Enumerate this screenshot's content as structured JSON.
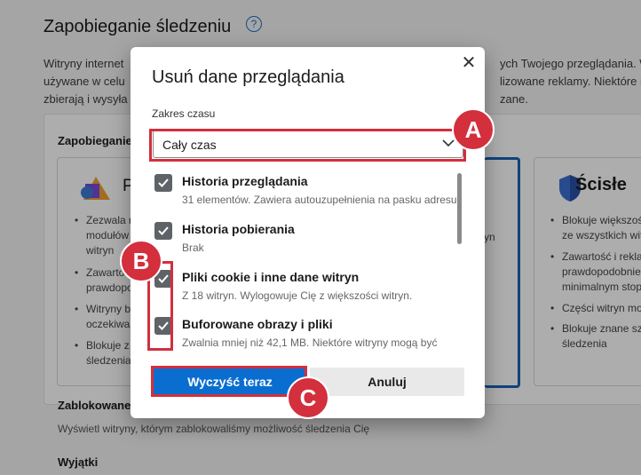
{
  "background": {
    "title": "Zapobieganie śledzeniu",
    "help_icon": "?",
    "desc_line1_left": "Witryny internet",
    "desc_line1_right": "ych Twojego przeglądania. W",
    "desc_line2_left": "używane w celu",
    "desc_line2_right": "lizowane reklamy. Niektóre n",
    "desc_line3_left": "zbierają i wysyła",
    "desc_line3_right": "zane.",
    "subhead": "Zapobieganie",
    "card1_heading": "P",
    "card1_items": [
      "Zezwala n",
      "modułów",
      "witryn",
      "Zawartoś",
      "prawdopo",
      "Witryny b",
      "oczekiwa",
      "Blokuje z",
      "śledzenia"
    ],
    "card2_items": [
      "yn"
    ],
    "card3_heading": "Ścisłe",
    "card3_items": [
      "Blokuje większoś",
      "ze wszystkich wit",
      "Zawartość i reklam",
      "prawdopodobnie",
      "minimalnym stop",
      "Części witryn mo",
      "Blokuje znane sz",
      "śledzenia"
    ],
    "blocked_heading": "Zablokowane",
    "blocked_desc": "Wyświetl witryny, którym zablokowaliśmy możliwość śledzenia Cię",
    "exceptions_heading": "Wyjątki"
  },
  "dialog": {
    "title": "Usuń dane przeglądania",
    "close_icon": "✕",
    "range_label": "Zakres czasu",
    "range_value": "Cały czas",
    "items": [
      {
        "title": "Historia przeglądania",
        "desc": "31 elementów. Zawiera autouzupełnienia na pasku adresu.",
        "checked": true
      },
      {
        "title": "Historia pobierania",
        "desc": "Brak",
        "checked": true
      },
      {
        "title": "Pliki cookie i inne dane witryn",
        "desc": "Z 18 witryn. Wylogowuje Cię z większości witryn.",
        "checked": true
      },
      {
        "title": "Buforowane obrazy i pliki",
        "desc": "Zwalnia mniej niż 42,1 MB. Niektóre witryny mogą być",
        "checked": true
      }
    ],
    "clear_button": "Wyczyść teraz",
    "cancel_button": "Anuluj"
  },
  "annotations": {
    "a": "A",
    "b": "B",
    "c": "C",
    "highlight_color": "#d32f3c"
  },
  "colors": {
    "primary": "#0a6ed1",
    "checkbox": "#5f6368"
  }
}
